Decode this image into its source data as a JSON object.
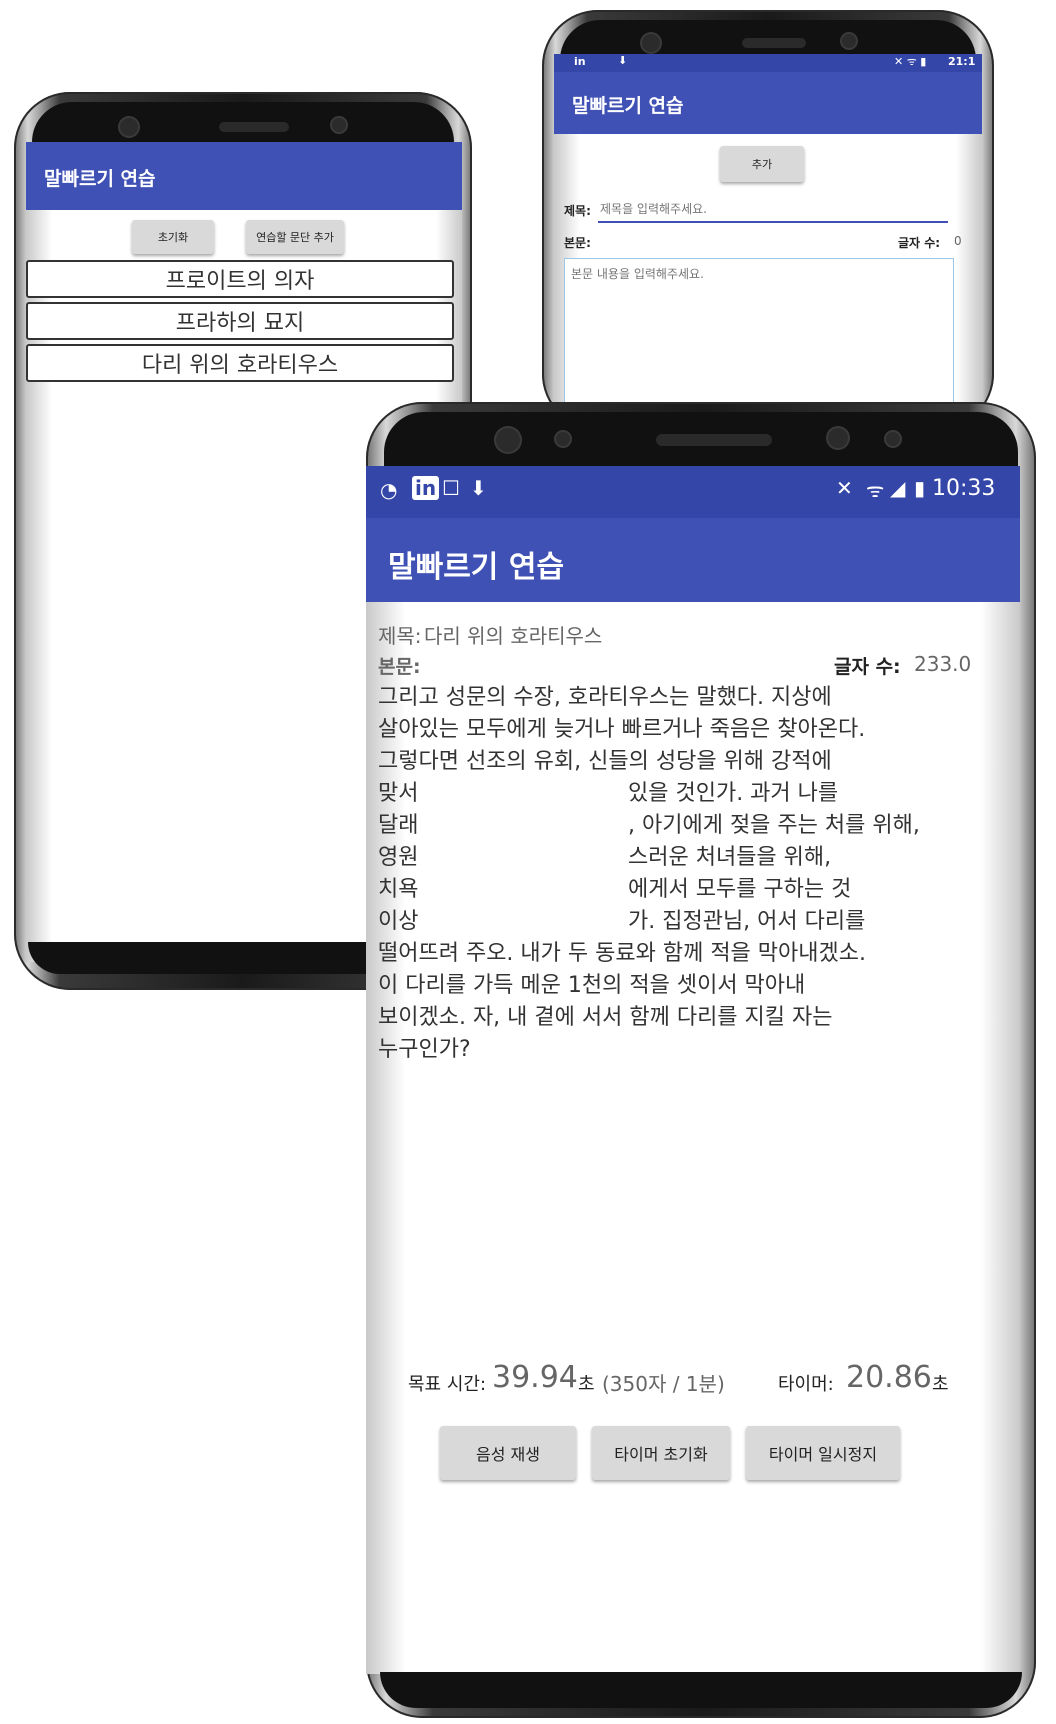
{
  "app_title": "말빠르기 연습",
  "list_screen": {
    "reset_button": "초기화",
    "add_paragraph_button": "연습할 문단 추가",
    "items": [
      "프로이트의 의자",
      "프라하의 묘지",
      "다리 위의 호라티우스"
    ]
  },
  "add_screen": {
    "status_time": "21:1",
    "add_button": "추가",
    "title_label": "제목:",
    "title_placeholder": "제목을 입력해주세요.",
    "body_label": "본문:",
    "char_count_label": "글자 수:",
    "char_count_value": "0",
    "body_placeholder": "본문 내용을 입력해주세요."
  },
  "practice_screen": {
    "status_time": "10:33",
    "title_label": "제목:",
    "title_value": "다리 위의 호라티우스",
    "body_label": "본문:",
    "char_count_label": "글자 수:",
    "char_count_value": "233.0",
    "body_lines": [
      "그리고 성문의 수장, 호라티우스는 말했다. 지상에",
      "살아있는 모두에게 늦거나 빠르거나 죽음은 찾아온다.",
      "그렇다면 선조의 유회, 신들의 성당을 위해 강적에",
      "맞서",
      "달래",
      "영원",
      "치욕",
      "이상",
      "떨어뜨려 주오. 내가 두 동료와 함께 적을 막아내겠소.",
      "이 다리를 가득 메운 1천의 적을 셋이서 막아내",
      "보이겠소. 자, 내 곁에 서서 함께 다리를 지킬 자는",
      "누구인가?"
    ],
    "body_fragments": [
      "있을 것인가. 과거 나를",
      ", 아기에게 젖을 주는 처를 위해,",
      "스러운 처녀들을 위해,",
      "에게서 모두를 구하는 것",
      "가. 집정관님, 어서 다리를"
    ],
    "target_time_label": "목표 시간:",
    "target_time_value": "39.94",
    "target_time_unit": "초",
    "target_time_rate": "(350자 / 1분)",
    "timer_label": "타이머:",
    "timer_value": "20.86",
    "timer_unit": "초",
    "buttons": {
      "play_voice": "음성 재생",
      "reset_timer": "타이머 초기화",
      "pause_timer": "타이머 일시정지"
    }
  },
  "colors": {
    "app_bar": "#3f51b5",
    "status_bar": "#3446a8",
    "button": "#d9d9d9"
  }
}
